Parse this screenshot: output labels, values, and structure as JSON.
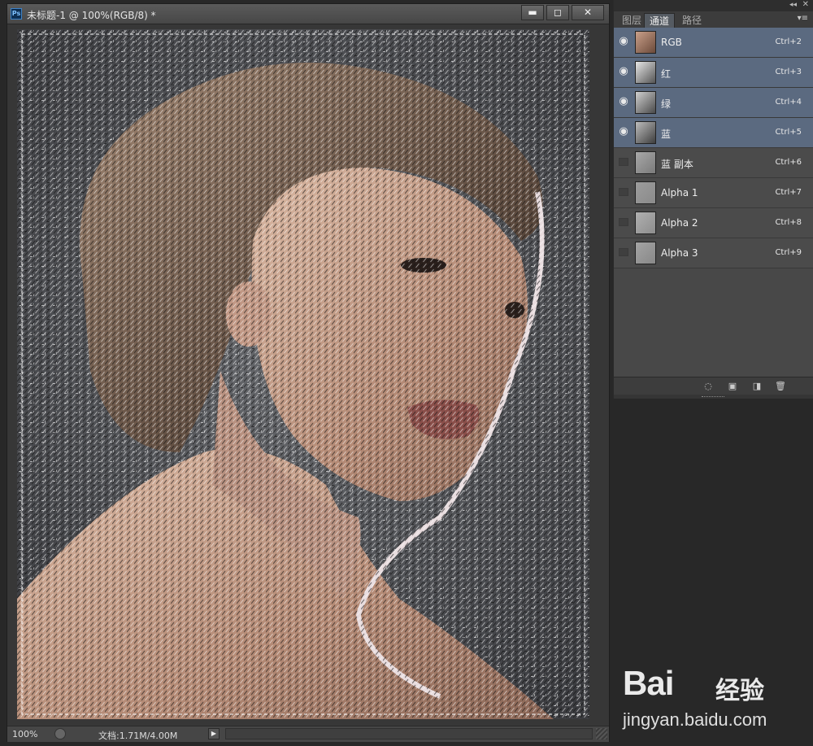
{
  "document": {
    "app_icon": "Ps",
    "title": "未标题-1 @ 100%(RGB/8) *",
    "window_buttons": {
      "minimize": "▬",
      "restore": "◻",
      "close": "✕"
    },
    "status": {
      "zoom": "100%",
      "doc_info": "文档:1.71M/4.00M",
      "arrow": "▶"
    }
  },
  "panel": {
    "collapse": "◂◂",
    "close": "✕",
    "tabs": [
      {
        "label": "图层"
      },
      {
        "label": "通道"
      },
      {
        "label": "路径"
      }
    ],
    "active_tab": "通道",
    "menu": "▾≡",
    "channels": [
      {
        "name": "RGB",
        "shortcut": "Ctrl+2",
        "visible": true,
        "selected": true
      },
      {
        "name": "红",
        "shortcut": "Ctrl+3",
        "visible": true,
        "selected": true
      },
      {
        "name": "绿",
        "shortcut": "Ctrl+4",
        "visible": true,
        "selected": true
      },
      {
        "name": "蓝",
        "shortcut": "Ctrl+5",
        "visible": true,
        "selected": true
      },
      {
        "name": "蓝 副本",
        "shortcut": "Ctrl+6",
        "visible": false,
        "selected": false
      },
      {
        "name": "Alpha 1",
        "shortcut": "Ctrl+7",
        "visible": false,
        "selected": false
      },
      {
        "name": "Alpha 2",
        "shortcut": "Ctrl+8",
        "visible": false,
        "selected": false
      },
      {
        "name": "Alpha 3",
        "shortcut": "Ctrl+9",
        "visible": false,
        "selected": false
      }
    ],
    "eye_glyph": "◉"
  },
  "watermark": {
    "logo": "Bai",
    "logo_cn": "经验",
    "url": "jingyan.baidu.com"
  },
  "colors": {
    "selection": "#5b6a80",
    "panel_bg": "#484848",
    "app_bg": "#282828"
  }
}
